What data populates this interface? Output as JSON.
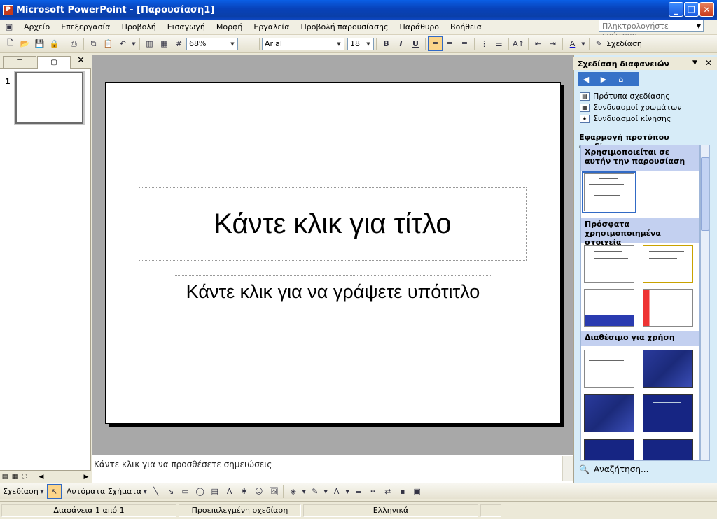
{
  "window": {
    "title": "Microsoft PowerPoint - [Παρουσίαση1]",
    "app_icon": "P"
  },
  "menu": {
    "items": [
      {
        "label": "Αρχείο"
      },
      {
        "label": "Επεξεργασία"
      },
      {
        "label": "Προβολή"
      },
      {
        "label": "Εισαγωγή"
      },
      {
        "label": "Μορφή"
      },
      {
        "label": "Εργαλεία"
      },
      {
        "label": "Προβολή παρουσίασης"
      },
      {
        "label": "Παράθυρο"
      },
      {
        "label": "Βοήθεια"
      }
    ],
    "help_placeholder": "Πληκτρολογήστε ερώτηση"
  },
  "toolbar": {
    "zoom": "68%",
    "font_name": "Arial",
    "font_size": "18",
    "bold": "B",
    "italic": "I",
    "underline": "U",
    "design_label": "Σχεδίαση"
  },
  "slides_pane": {
    "slide_number": "1"
  },
  "slide": {
    "title_placeholder": "Κάντε κλικ για τίτλο",
    "subtitle_placeholder": "Κάντε κλικ για να γράψετε υπότιτλο"
  },
  "notes": {
    "placeholder": "Κάντε κλικ για να προσθέσετε σημειώσεις"
  },
  "task_pane": {
    "title": "Σχεδίαση διαφανειών",
    "links": [
      "Πρότυπα σχεδίασης",
      "Συνδυασμοί χρωμάτων",
      "Συνδυασμοί κίνησης"
    ],
    "apply_label": "Εφαρμογή προτύπου σχεδίασης:",
    "sections": {
      "used": "Χρησιμοποιείται σε αυτήν την παρουσίαση",
      "recent": "Πρόσφατα χρησιμοποιημένα στοιχεία",
      "available": "Διαθέσιμο για χρήση"
    },
    "search_label": "Αναζήτηση..."
  },
  "drawing": {
    "draw_label": "Σχεδίαση",
    "autoshapes_label": "Αυτόματα Σχήματα"
  },
  "status": {
    "slide_info": "Διαφάνεια 1 από 1",
    "design": "Προεπιλεγμένη σχεδίαση",
    "language": "Ελληνικά"
  },
  "colors": {
    "accent": "#316ac5",
    "titlebar": "#0842b9",
    "task_pane": "#d7ecf8"
  }
}
